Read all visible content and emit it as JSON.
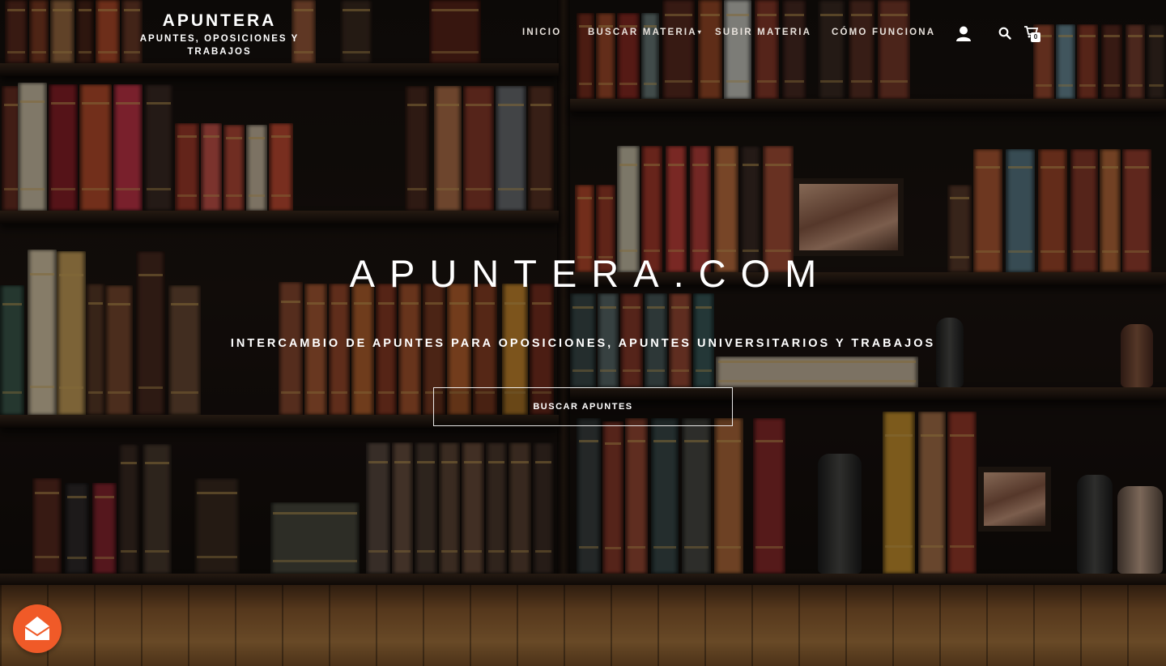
{
  "header": {
    "brand_title": "APUNTERA",
    "brand_tagline": "APUNTES, OPOSICIONES Y TRABAJOS"
  },
  "nav": {
    "items": [
      {
        "label": "INICIO"
      },
      {
        "label": "BUSCAR MATERIA",
        "has_dropdown": true
      },
      {
        "label": "SUBIR MATERIA"
      },
      {
        "label": "CÓMO FUNCIONA"
      }
    ],
    "icons": [
      "user-icon",
      "search-icon",
      "cart-icon"
    ],
    "cart_count": "0"
  },
  "hero": {
    "title": "APUNTERA.COM",
    "subtitle": "INTERCAMBIO DE APUNTES PARA OPOSICIONES, APUNTES UNIVERSITARIOS Y TRABAJOS",
    "button_label": "BUSCAR APUNTES"
  },
  "fab": {
    "icon": "envelope-icon",
    "color": "#f05a28"
  },
  "colors": {
    "text": "#ffffff",
    "accent": "#f05a28"
  }
}
